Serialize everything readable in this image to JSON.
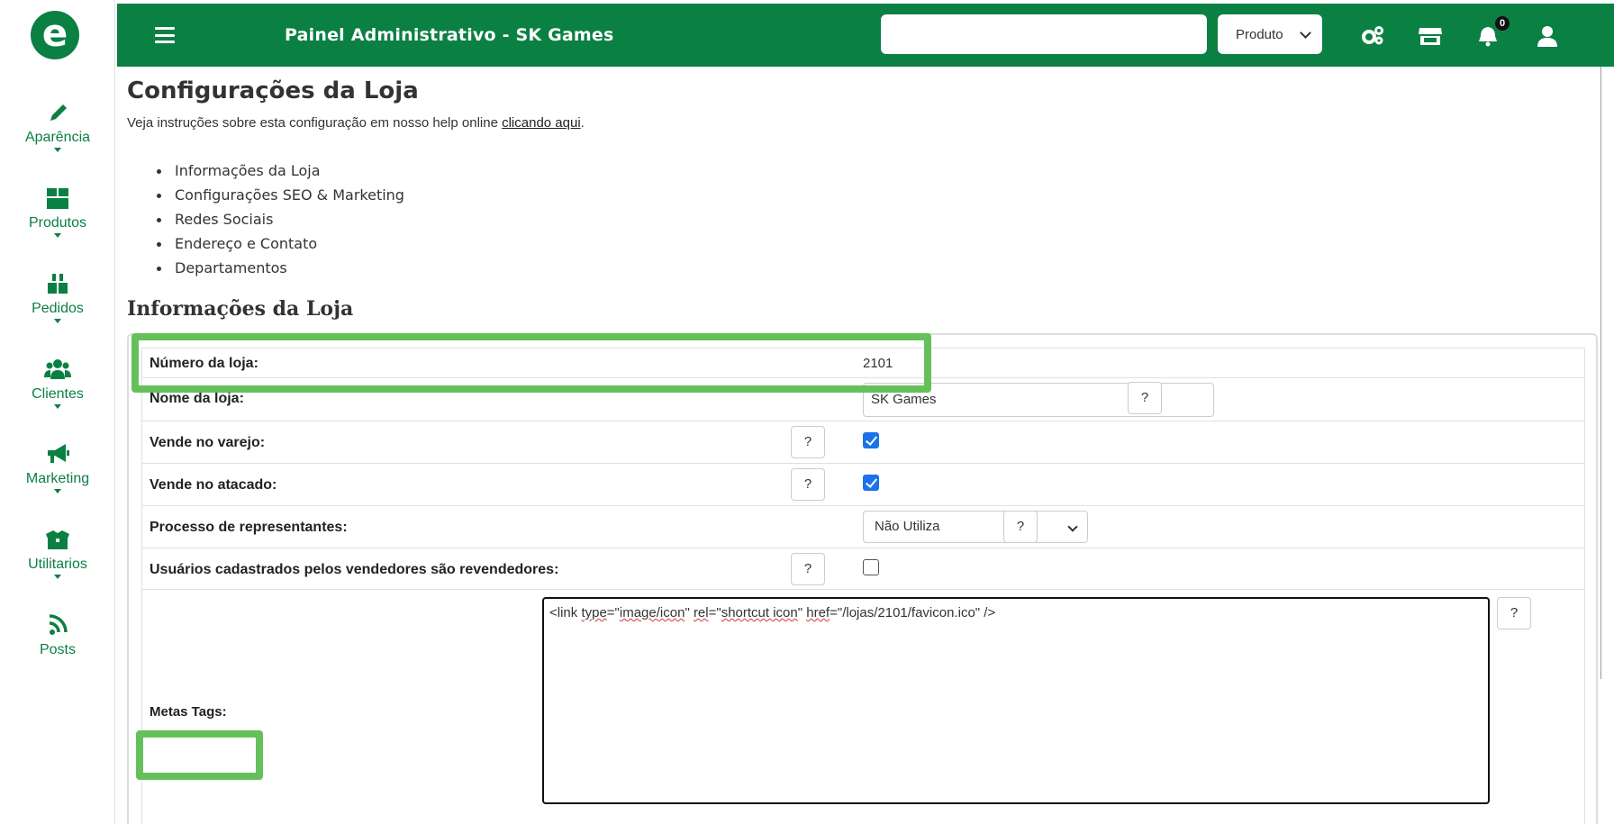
{
  "colors": {
    "brand": "#0b8043",
    "highlight": "#66c05a",
    "checkbox": "#1a73e8"
  },
  "sidebar": {
    "logo_letter": "e",
    "items": [
      {
        "label": "Aparência",
        "icon": "pencil-icon"
      },
      {
        "label": "Produtos",
        "icon": "box-icon"
      },
      {
        "label": "Pedidos",
        "icon": "boxes-icon"
      },
      {
        "label": "Clientes",
        "icon": "users-icon"
      },
      {
        "label": "Marketing",
        "icon": "megaphone-icon"
      },
      {
        "label": "Utilitarios",
        "icon": "toolbox-icon"
      },
      {
        "label": "Posts",
        "icon": "rss-icon"
      }
    ]
  },
  "topbar": {
    "title": "Painel Administrativo - SK Games",
    "search_value": "",
    "select_value": "Produto",
    "notification_count": "0",
    "icons": [
      "menu-icon",
      "gears-icon",
      "store-icon",
      "bell-icon",
      "user-icon"
    ]
  },
  "main": {
    "title": "Configurações da Loja",
    "intro_text": "Veja instruções sobre esta configuração em nosso help online ",
    "intro_link": "clicando aqui",
    "intro_end": ".",
    "links": [
      "Informações da Loja",
      "Configurações SEO & Marketing",
      "Redes Sociais",
      "Endereço e Contato",
      "Departamentos"
    ],
    "section_title": "Informações da Loja",
    "help_label": "?",
    "fields": {
      "numero": {
        "label": "Número da loja:",
        "value": "2101"
      },
      "nome": {
        "label": "Nome da loja:",
        "value": "SK Games"
      },
      "varejo": {
        "label": "Vende no varejo:",
        "checked": true
      },
      "atacado": {
        "label": "Vende no atacado:",
        "checked": true
      },
      "representantes": {
        "label": "Processo de representantes:",
        "value": "Não Utiliza"
      },
      "revendedores": {
        "label": "Usuários cadastrados pelos vendedores são revendedores:",
        "checked": false
      },
      "metas": {
        "label": "Metas Tags:",
        "value_parts": [
          "<link ",
          "type",
          "=\"",
          "image/icon",
          "\" ",
          "rel",
          "=\"",
          "shortcut icon",
          "\" ",
          "href",
          "=\"/lojas/2101/favicon.ico\" />"
        ]
      }
    }
  }
}
